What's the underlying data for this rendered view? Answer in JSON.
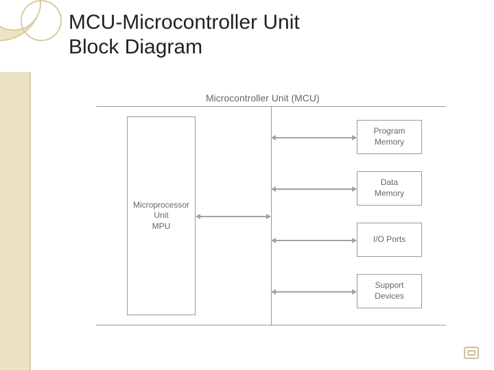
{
  "title_line1": "MCU-Microcontroller Unit",
  "title_line2": "Block Diagram",
  "subtitle": "Microcontroller Unit (MCU)",
  "blocks": {
    "mpu": "Microprocessor\nUnit\nMPU",
    "program_memory": "Program\nMemory",
    "data_memory": "Data\nMemory",
    "io_ports": "I/O Ports",
    "support_devices": "Support\nDevices"
  },
  "diagram_structure": {
    "left_block": "mpu",
    "bus": "vertical-shared-bus",
    "right_blocks": [
      "program_memory",
      "data_memory",
      "io_ports",
      "support_devices"
    ],
    "connections": [
      {
        "from": "mpu",
        "to": "bus",
        "dir": "bidirectional"
      },
      {
        "from": "bus",
        "to": "program_memory",
        "dir": "bidirectional"
      },
      {
        "from": "bus",
        "to": "data_memory",
        "dir": "bidirectional"
      },
      {
        "from": "bus",
        "to": "io_ports",
        "dir": "bidirectional"
      },
      {
        "from": "bus",
        "to": "support_devices",
        "dir": "bidirectional"
      }
    ]
  }
}
